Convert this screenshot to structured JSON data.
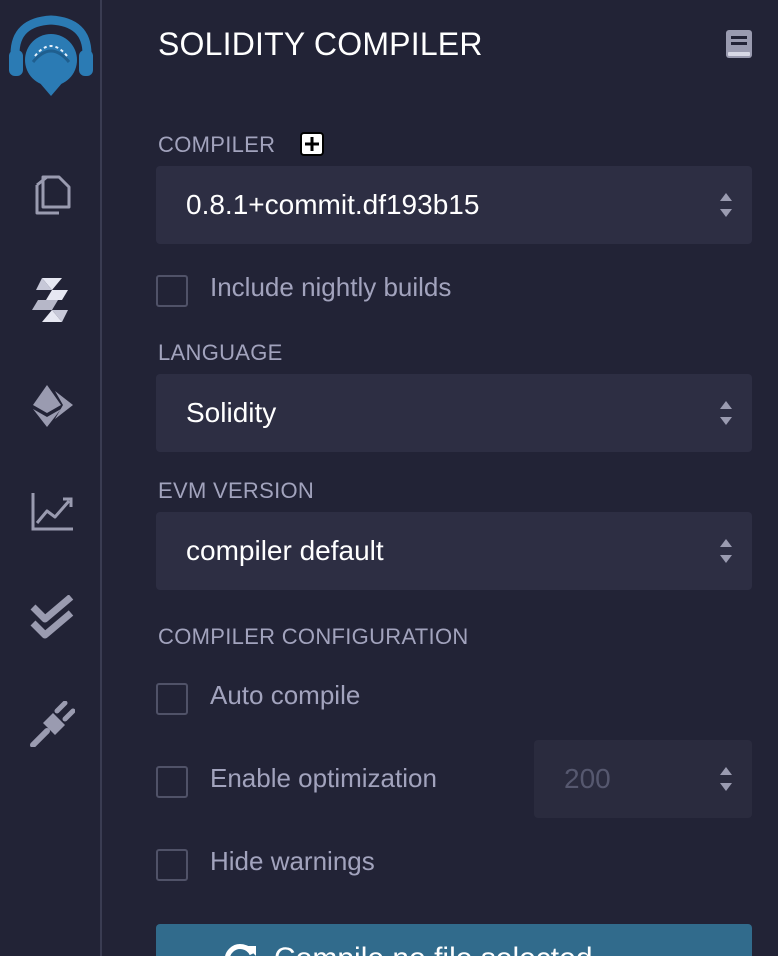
{
  "panel": {
    "title": "SOLIDITY COMPILER"
  },
  "rail": {
    "items": [
      {
        "icon": "remix-logo-icon"
      },
      {
        "icon": "file-explorer-icon"
      },
      {
        "icon": "solidity-compiler-icon"
      },
      {
        "icon": "deploy-run-icon"
      },
      {
        "icon": "analysis-chart-icon"
      },
      {
        "icon": "testing-double-check-icon"
      },
      {
        "icon": "plugin-manager-icon"
      }
    ]
  },
  "compiler": {
    "label": "COMPILER",
    "selected": "0.8.1+commit.df193b15",
    "nightly_label": "Include nightly builds",
    "nightly_checked": false
  },
  "language": {
    "label": "LANGUAGE",
    "selected": "Solidity"
  },
  "evm": {
    "label": "EVM VERSION",
    "selected": "compiler default"
  },
  "config": {
    "label": "COMPILER CONFIGURATION",
    "auto_compile_label": "Auto compile",
    "auto_compile_checked": false,
    "optimization_label": "Enable optimization",
    "optimization_checked": false,
    "runs_value": "200",
    "hide_warnings_label": "Hide warnings",
    "hide_warnings_checked": false
  },
  "compile_button": {
    "label": "Compile no file selected"
  },
  "colors": {
    "background": "#222336",
    "field": "#2d2e43",
    "muted_text": "#a2a3bd",
    "brand_blue": "#2b7bb4",
    "compile_button": "#316b8c"
  }
}
